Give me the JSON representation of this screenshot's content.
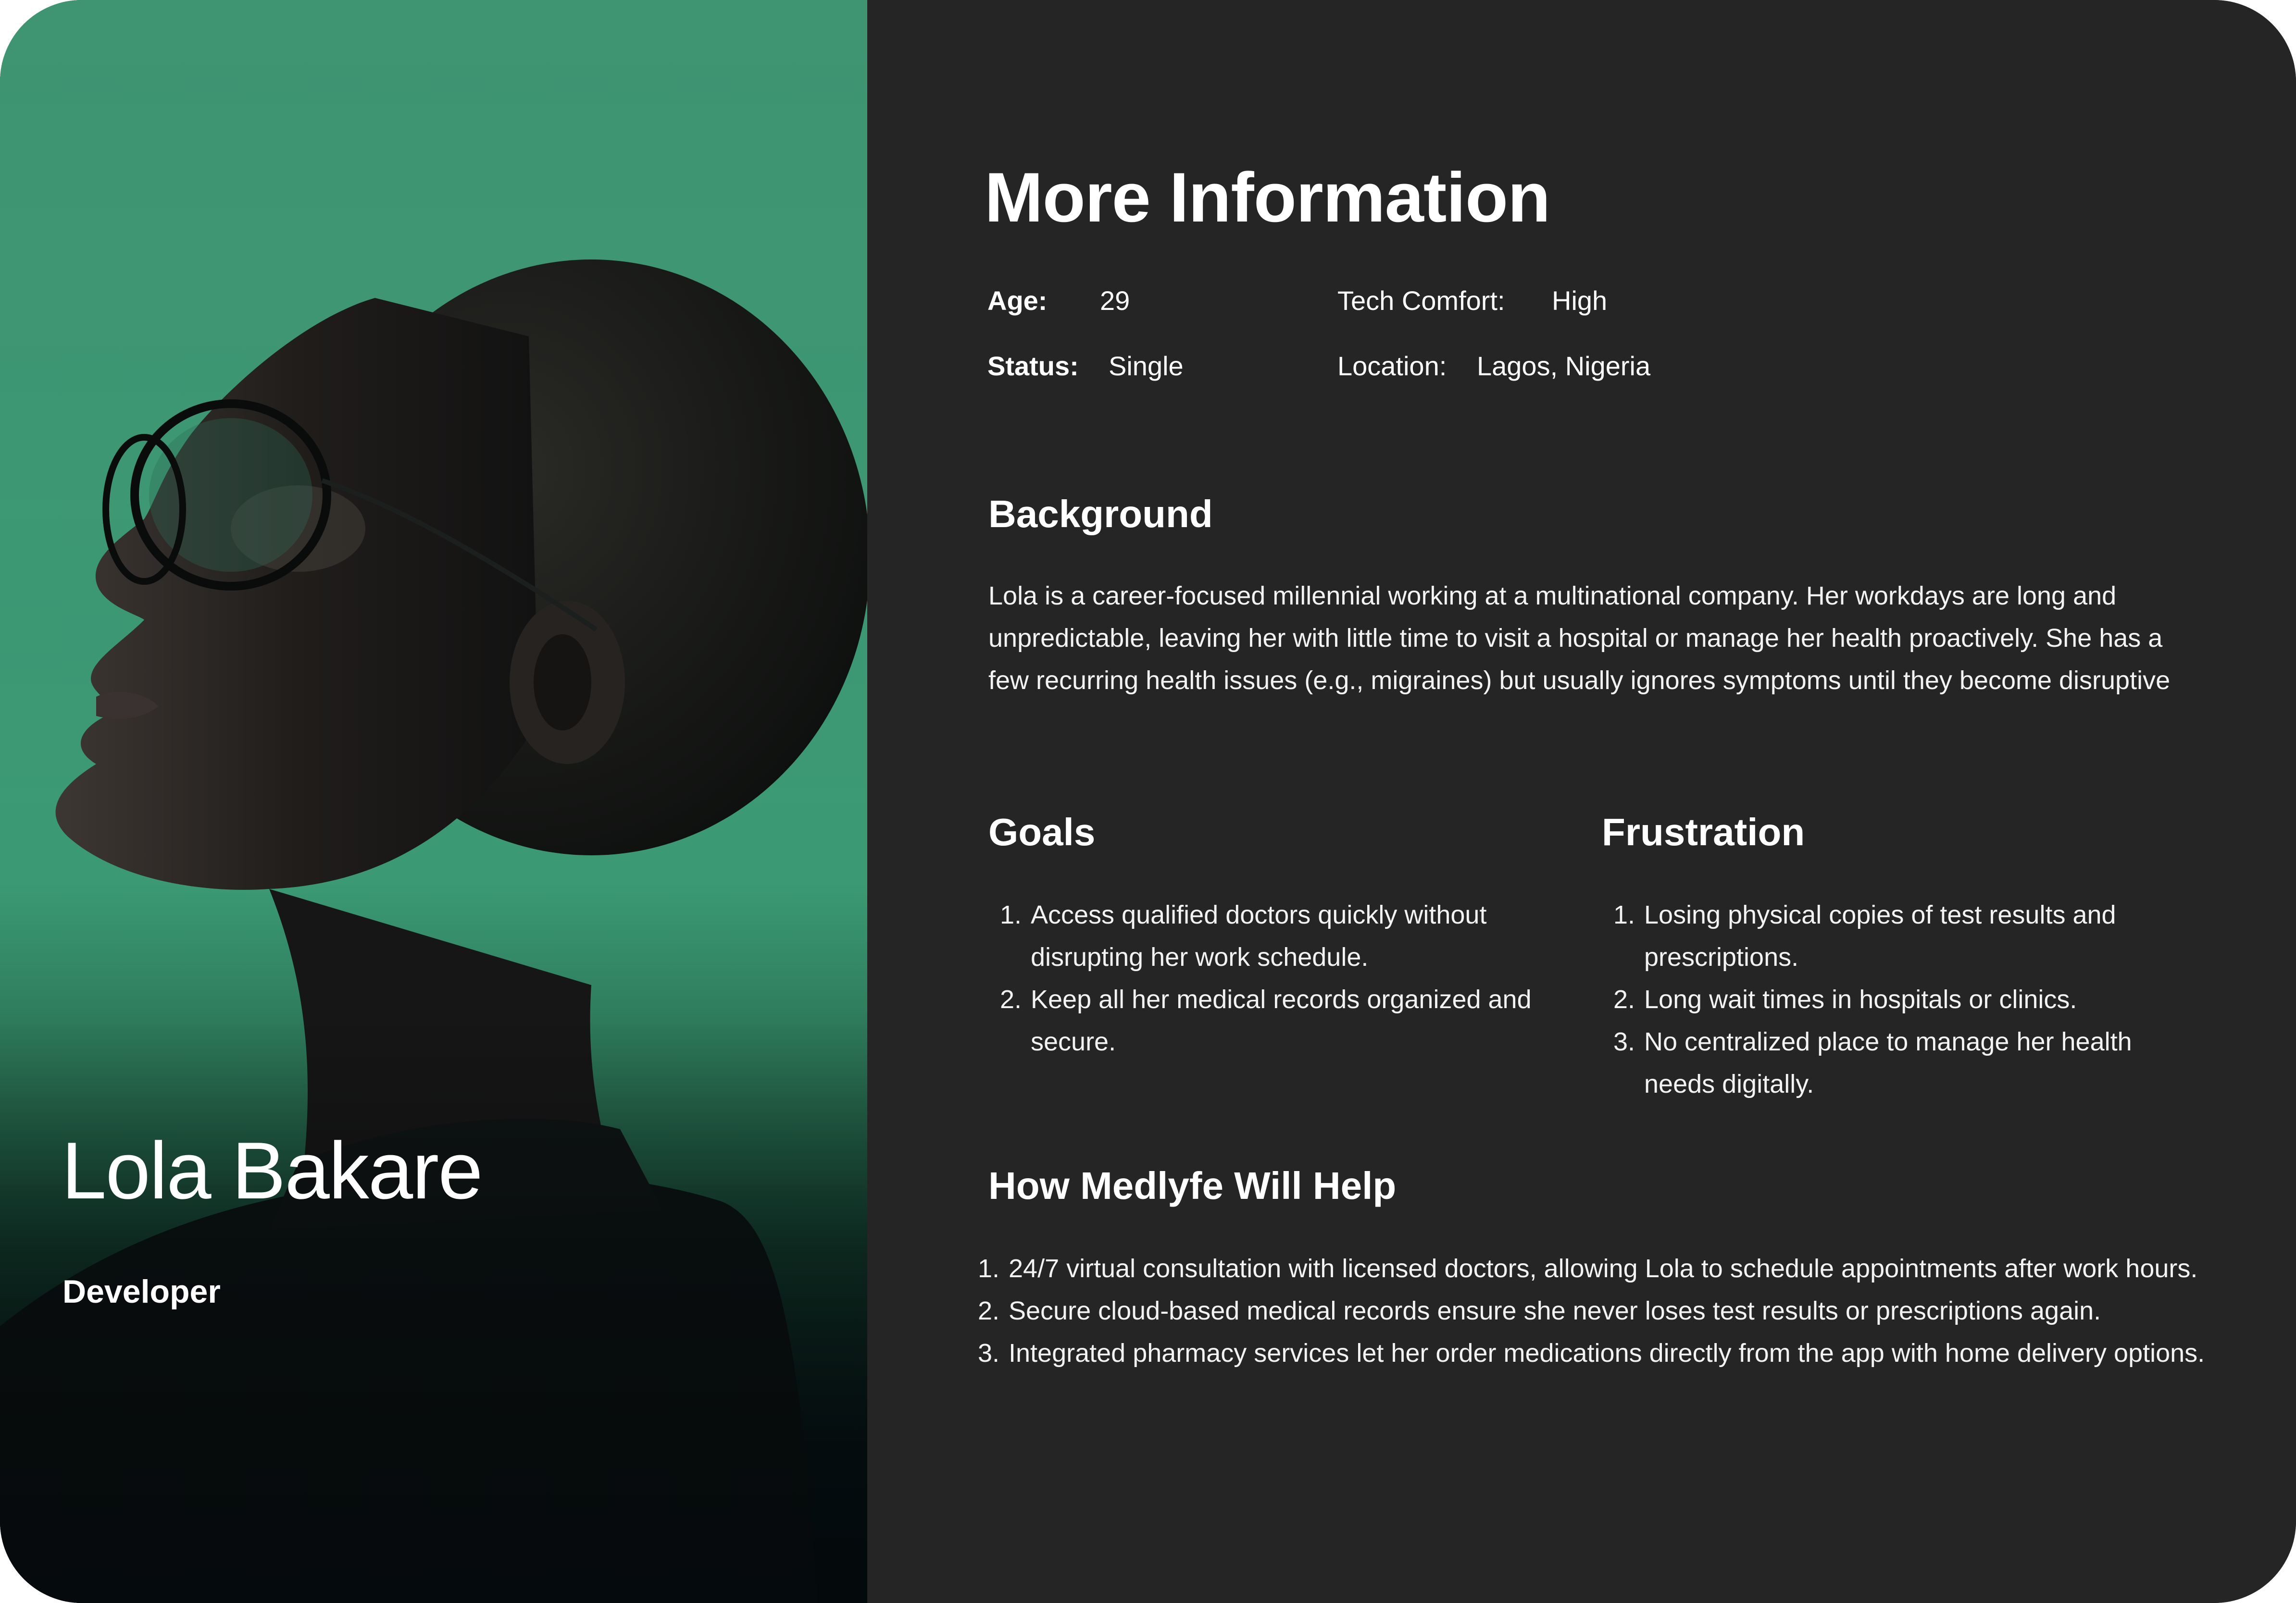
{
  "persona": {
    "name": "Lola Bakare",
    "role": "Developer"
  },
  "info": {
    "title": "More Information",
    "age_label": "Age:",
    "age_value": "29",
    "status_label": "Status:",
    "status_value": "Single",
    "tech_label": "Tech Comfort:",
    "tech_value": "High",
    "location_label": "Location:",
    "location_value": "Lagos, Nigeria"
  },
  "background": {
    "title": "Background",
    "text": "Lola is a career-focused millennial working at a multinational company. Her workdays are long and unpredictable, leaving her with little time to visit a hospital or manage her health proactively. She has a few recurring health issues (e.g., migraines) but usually ignores symptoms until they become disruptive"
  },
  "goals": {
    "title": "Goals",
    "items": [
      "Access qualified doctors quickly without disrupting her work schedule.",
      "Keep all her medical records organized and secure."
    ]
  },
  "frustration": {
    "title": "Frustration",
    "items": [
      "Losing physical copies of test results and prescriptions.",
      "Long wait times in hospitals or clinics.",
      "No centralized place to manage her health needs digitally."
    ]
  },
  "help": {
    "title": "How Medlyfe Will Help",
    "items": [
      "24/7 virtual consultation with licensed doctors, allowing Lola to schedule appointments after work hours.",
      "Secure cloud-based medical records ensure she never loses test results or prescriptions again.",
      "Integrated pharmacy services let her order medications directly from the app with home delivery options."
    ]
  },
  "colors": {
    "panel_green": "#3f9873",
    "panel_dark": "#252525",
    "text": "#ffffff"
  }
}
